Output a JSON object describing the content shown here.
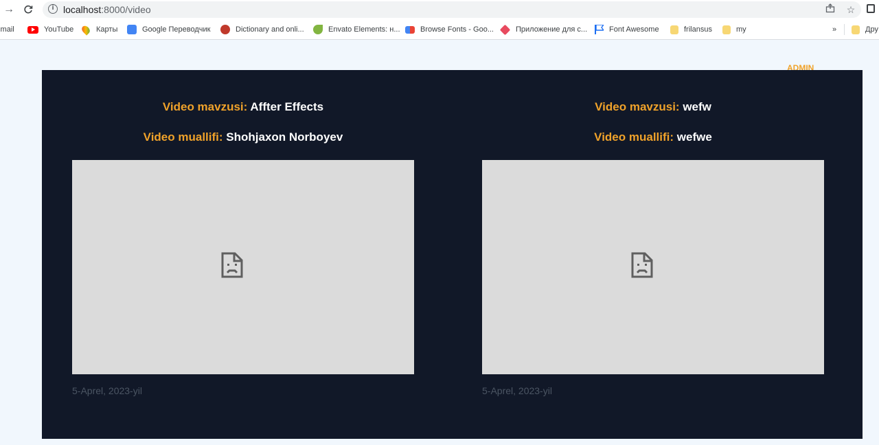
{
  "browser": {
    "url_host": "localhost",
    "url_path": ":8000/video",
    "icons": [
      "back-arrow-icon",
      "reload-icon",
      "info-icon",
      "share-icon",
      "star-icon",
      "extensions-icon"
    ],
    "overflow_label": "»",
    "bookmarks": [
      {
        "label": "Gmail",
        "icon": "gmail-icon",
        "color": "#ea4335"
      },
      {
        "label": "YouTube",
        "icon": "youtube-icon",
        "color": "#ff0000"
      },
      {
        "label": "Карты",
        "icon": "maps-pin-icon",
        "color": "#34a853"
      },
      {
        "label": "Google Переводчик",
        "icon": "translate-icon",
        "color": "#4285f4"
      },
      {
        "label": "Dictionary and onli...",
        "icon": "dictionary-icon",
        "color": "#c0392b"
      },
      {
        "label": "Envato Elements: н...",
        "icon": "envato-leaf-icon",
        "color": "#82b541"
      },
      {
        "label": "Browse Fonts - Goo...",
        "icon": "google-fonts-icon",
        "color": "#4285f4"
      },
      {
        "label": "Приложение для с...",
        "icon": "app-diamond-icon",
        "color": "#e84a5f"
      },
      {
        "label": "Font Awesome",
        "icon": "font-awesome-flag-icon",
        "color": "#1c6ef2"
      },
      {
        "label": "frilansus",
        "icon": "folder-icon",
        "color": "#f7d774"
      },
      {
        "label": "my",
        "icon": "folder-icon",
        "color": "#f7d774"
      },
      {
        "label": "Дру",
        "icon": "folder-icon",
        "color": "#f7d774"
      }
    ]
  },
  "page": {
    "admin_label": "ADMIN",
    "accent_color": "#f0a22a",
    "panel_color": "#111828",
    "videos": [
      {
        "topic_label": "Video mavzusi:",
        "topic": "Affter Effects",
        "author_label": "Video muallifi:",
        "author": "Shohjaxon Norboyev",
        "date": "5-Aprel, 2023-yil",
        "icon": "broken-page-icon"
      },
      {
        "topic_label": "Video mavzusi:",
        "topic": "wefw",
        "author_label": "Video muallifi:",
        "author": "wefwe",
        "date": "5-Aprel, 2023-yil",
        "icon": "broken-page-icon"
      }
    ]
  }
}
